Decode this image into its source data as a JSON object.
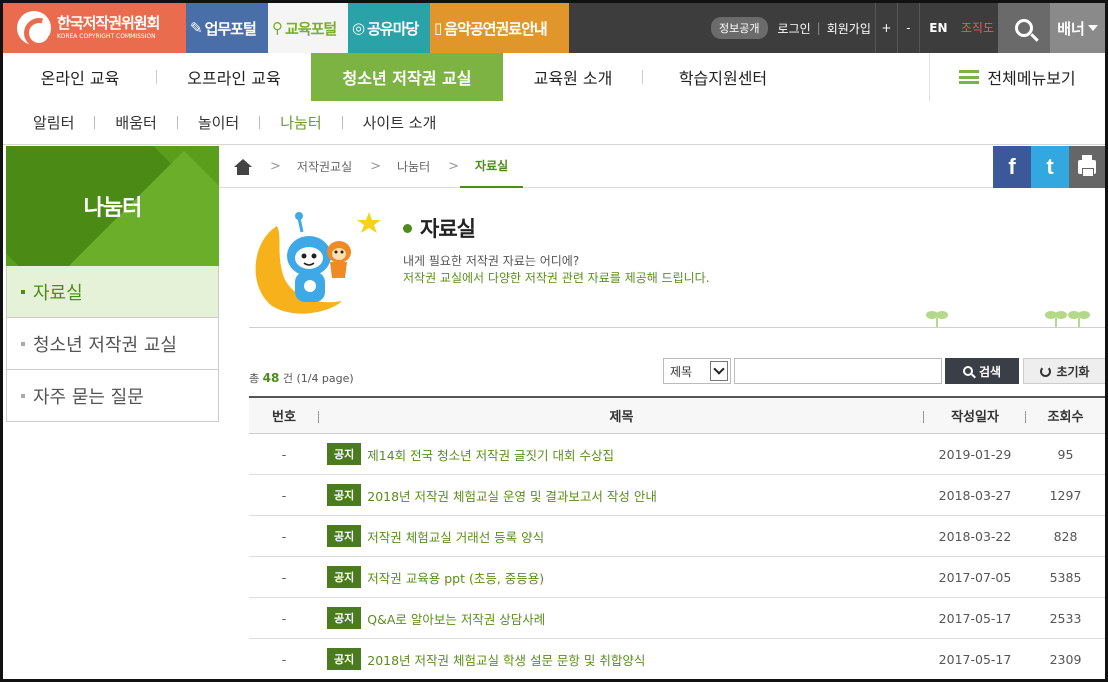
{
  "logo": {
    "name_ko": "한국저작권위원회",
    "name_en": "KOREA COPYRIGHT COMMISSION"
  },
  "portals": [
    {
      "label": "업무포털",
      "icon": "✎"
    },
    {
      "label": "교육포털",
      "icon": "⚲"
    },
    {
      "label": "공유마당",
      "icon": "◎"
    },
    {
      "label": "음악공연권료안내",
      "icon": "▯"
    }
  ],
  "util": {
    "info": "정보공개",
    "login": "로그인",
    "join": "회원가입",
    "plus": "+",
    "minus": "-",
    "en": "EN",
    "org": "조직도",
    "banner": "배너"
  },
  "main_nav": {
    "items": [
      "온라인 교육",
      "오프라인 교육",
      "청소년 저작권 교실",
      "교육원 소개",
      "학습지원센터"
    ],
    "all_menu": "전체메뉴보기"
  },
  "sub_nav": [
    "알림터",
    "배움터",
    "놀이터",
    "나눔터",
    "사이트 소개"
  ],
  "sidebar": {
    "title": "나눔터",
    "items": [
      "자료실",
      "청소년 저작권 교실",
      "자주 묻는 질문"
    ]
  },
  "breadcrumb": [
    "저작권교실",
    "나눔터",
    "자료실"
  ],
  "social": {
    "facebook": "f",
    "twitter": "t"
  },
  "page": {
    "title": "자료실",
    "desc1": "내게 필요한 저작권 자료는 어디에?",
    "desc2": "저작권 교실에서 다양한 저작권 관련 자료를 제공해 드립니다."
  },
  "list": {
    "count_prefix": "총",
    "count": "48",
    "count_suffix": "건 (1/4 page)",
    "select_value": "제목",
    "search_value": "",
    "search_btn": "검색",
    "reset_btn": "초기화",
    "headers": [
      "번호",
      "제목",
      "작성일자",
      "조회수"
    ],
    "badge": "공지",
    "rows": [
      {
        "no": "-",
        "title": "제14회 전국 청소년 저작권 글짓기 대회 수상집",
        "date": "2019-01-29",
        "views": "95"
      },
      {
        "no": "-",
        "title": "2018년 저작권 체험교실 운영 및 결과보고서 작성 안내",
        "date": "2018-03-27",
        "views": "1297"
      },
      {
        "no": "-",
        "title": "저작권 체험교실 거래선 등록 양식",
        "date": "2018-03-22",
        "views": "828"
      },
      {
        "no": "-",
        "title": "저작권 교육용 ppt (초등, 중등용)",
        "date": "2017-07-05",
        "views": "5385"
      },
      {
        "no": "-",
        "title": "Q&A로 알아보는 저작권 상담사례",
        "date": "2017-05-17",
        "views": "2533"
      },
      {
        "no": "-",
        "title": "2018년 저작권 체험교실 학생 설문 문항 및 취합양식",
        "date": "2017-05-17",
        "views": "2309"
      }
    ]
  },
  "colors": {
    "green": "#7cb342",
    "dark_green": "#4c8c18",
    "logo_orange": "#ea6c4f"
  }
}
